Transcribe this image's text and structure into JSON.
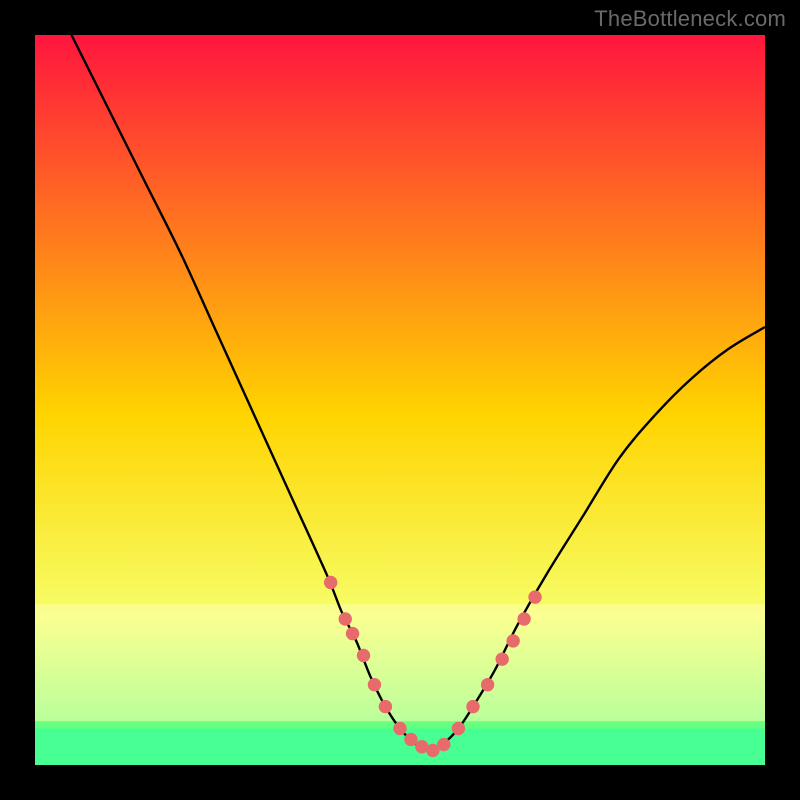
{
  "watermark": "TheBottleneck.com",
  "colors": {
    "frame": "#000000",
    "line": "#000000",
    "watermark": "#6a6a6a",
    "dot_fill": "#e86b6b",
    "band": "#47ff93",
    "gradient_top": "#ff153e",
    "gradient_mid": "#ffd400",
    "gradient_low": "#f6ff6b",
    "gradient_bottom": "#2fff88"
  },
  "chart_data": {
    "type": "line",
    "title": "",
    "xlabel": "",
    "ylabel": "",
    "xlim": [
      0,
      100
    ],
    "ylim": [
      0,
      100
    ],
    "series": [
      {
        "name": "curve",
        "x": [
          5,
          10,
          15,
          20,
          25,
          30,
          35,
          40,
          42,
          44,
          46,
          48,
          50,
          52,
          54,
          56,
          58,
          60,
          63,
          66,
          70,
          75,
          80,
          85,
          90,
          95,
          100
        ],
        "y": [
          100,
          90,
          80,
          70,
          59,
          48,
          37,
          26,
          21,
          17,
          12,
          8,
          5,
          3,
          2,
          3,
          5,
          8,
          13,
          19,
          26,
          34,
          42,
          48,
          53,
          57,
          60
        ]
      }
    ],
    "dots": {
      "name": "highlight-dots",
      "x": [
        40.5,
        42.5,
        43.5,
        45,
        46.5,
        48,
        50,
        51.5,
        53,
        54.5,
        56,
        58,
        60,
        62,
        64,
        65.5,
        67,
        68.5
      ],
      "y": [
        25,
        20,
        18,
        15,
        11,
        8,
        5,
        3.5,
        2.5,
        2,
        2.8,
        5,
        8,
        11,
        14.5,
        17,
        20,
        23
      ]
    },
    "optimal_band": {
      "y_start": 0,
      "y_end": 5
    }
  }
}
